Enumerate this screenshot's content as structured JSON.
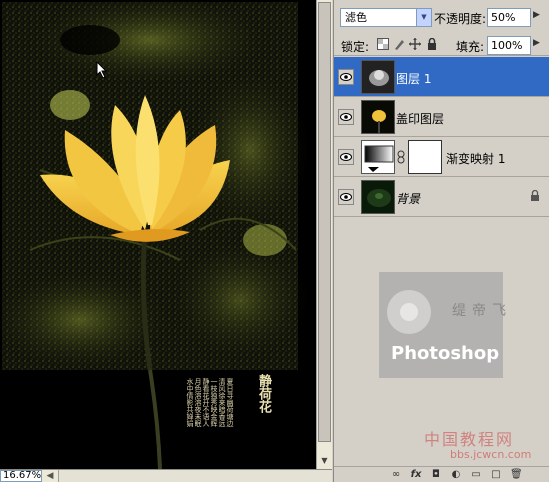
{
  "document": {
    "poem_title": "静荷花",
    "poem_lines": [
      "夏日寻幽荷塘边",
      "清风徐来暗香远",
      "一枝独秀映金辉",
      "静看花开不语人",
      "月色溶溶夜未眠",
      "水中倩影共婵娟"
    ],
    "zoom": "16.67%"
  },
  "layers_panel": {
    "blend_mode": "滤色",
    "opacity_label": "不透明度:",
    "opacity_value": "50%",
    "lock_label": "锁定:",
    "fill_label": "填充:",
    "fill_value": "100%",
    "layers": [
      {
        "name": "图层 1",
        "selected": true
      },
      {
        "name": "盖印图层",
        "selected": false
      },
      {
        "name": "渐变映射 1",
        "selected": false
      },
      {
        "name": "背景",
        "selected": false
      }
    ]
  },
  "watermark": {
    "logo_text": "Photoshop",
    "cn_text": "缇帝飞",
    "site_cn": "中国教程网",
    "site": "bbs.jcwcn.com"
  },
  "colors": {
    "selection": "#316ac5",
    "panel_bg": "#d4d0c8",
    "flower": "#f2c23a"
  }
}
